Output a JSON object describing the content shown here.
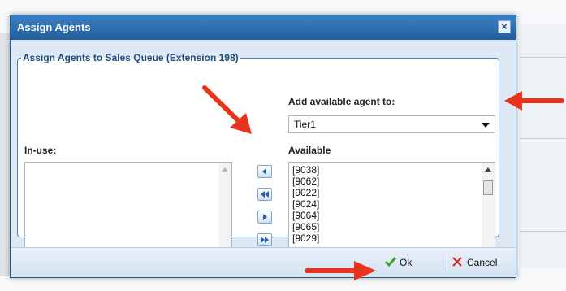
{
  "dialog": {
    "title": "Assign Agents",
    "close_symbol": "×"
  },
  "group": {
    "legend": "Assign Agents to Sales Queue (Extension 198)"
  },
  "add_to": {
    "label": "Add available agent to:",
    "selected": "Tier1"
  },
  "in_use": {
    "label": "In-use:",
    "items": []
  },
  "available": {
    "label": "Available",
    "items": [
      "[9038]",
      "[9062]",
      "[9022]",
      "[9024]",
      "[9064]",
      "[9065]",
      "[9029]"
    ]
  },
  "move_buttons": [
    {
      "icon": "arrow-left-icon"
    },
    {
      "icon": "double-arrow-left-icon"
    },
    {
      "icon": "arrow-right-icon"
    },
    {
      "icon": "double-arrow-right-icon"
    }
  ],
  "footer": {
    "ok_label": "Ok",
    "cancel_label": "Cancel"
  },
  "colors": {
    "titlebar": "#2b6cab",
    "annotation_arrow": "#e8341c",
    "ok_check": "#3aa530",
    "cancel_x": "#d9261c"
  }
}
